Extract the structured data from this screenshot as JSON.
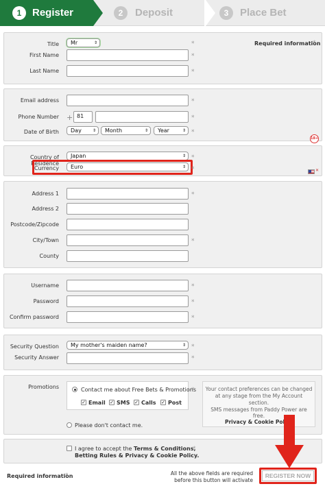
{
  "steps": [
    {
      "num": "1",
      "label": "Register"
    },
    {
      "num": "2",
      "label": "Deposit"
    },
    {
      "num": "3",
      "label": "Place Bet"
    }
  ],
  "personal": {
    "required_info": "Required information",
    "title_label": "Title",
    "title_value": "Mr",
    "first_name_label": "First Name",
    "last_name_label": "Last Name"
  },
  "contact": {
    "email_label": "Email address",
    "phone_label": "Phone Number",
    "phone_plus": "+",
    "phone_code": "81",
    "dob_label": "Date of Birth",
    "dob_day": "Day",
    "dob_month": "Month",
    "dob_year": "Year",
    "age_badge": "18+"
  },
  "residence": {
    "country_label": "Country of Residence",
    "country_value": "Japan",
    "currency_label": "Currency",
    "currency_value": "Euro",
    "highlight_color": "#e0241b"
  },
  "address": {
    "address1_label": "Address 1",
    "address2_label": "Address 2",
    "postcode_label": "Postcode/Zipcode",
    "city_label": "City/Town",
    "county_label": "County"
  },
  "account": {
    "username_label": "Username",
    "password_label": "Password",
    "confirm_password_label": "Confirm password"
  },
  "security": {
    "question_label": "Security Question",
    "question_value": "My mother's maiden name?",
    "answer_label": "Security Answer"
  },
  "promotions": {
    "label": "Promotions",
    "contact_me": "Contact me about Free Bets & Promotions",
    "email": "Email",
    "sms": "SMS",
    "calls": "Calls",
    "post": "Post",
    "dont_contact": "Please don't contact me.",
    "info_line1": "Your contact preferences can be changed",
    "info_line2": "at any stage from the My Account",
    "info_line3": "section.",
    "info_line4": "SMS messages from Paddy Power are",
    "info_line5": "free.",
    "privacy_link": "Privacy & Cookie Policy"
  },
  "terms": {
    "prefix": "I agree to accept the",
    "link1": "Terms & Conditions,",
    "link2": "Betting Rules & Privacy & Cookie Policy."
  },
  "footer": {
    "required_info": "Required information",
    "note_line1": "All the above fields are required",
    "note_line2": "before this button will activate",
    "register_button": "REGISTER NOW"
  },
  "colors": {
    "brand_green": "#1f7a3d",
    "annotation_red": "#e0241b"
  }
}
